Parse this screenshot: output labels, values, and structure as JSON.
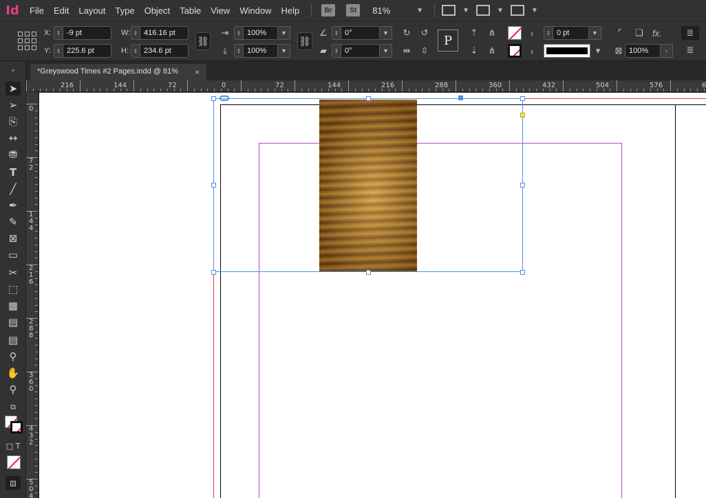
{
  "app": {
    "logo": "Id"
  },
  "menu": [
    "File",
    "Edit",
    "Layout",
    "Type",
    "Object",
    "Table",
    "View",
    "Window",
    "Help"
  ],
  "bridge": {
    "br": "Br",
    "st": "St"
  },
  "zoom": "81%",
  "control": {
    "x_label": "X:",
    "x_value": "-9 pt",
    "y_label": "Y:",
    "y_value": "225.6 pt",
    "w_label": "W:",
    "w_value": "416.16 pt",
    "h_label": "H:",
    "h_value": "234.6 pt",
    "scale_x": "100%",
    "scale_y": "100%",
    "rotate": "0°",
    "shear": "0°",
    "stroke_weight": "0 pt",
    "opacity": "100%",
    "p_button": "P",
    "fx": "fx."
  },
  "document_tab": {
    "title": "*Greyswood Times #2 Pages.indd @ 81%",
    "close": "×"
  },
  "ruler_top": [
    "216",
    "144",
    "72",
    "0",
    "72",
    "144",
    "216",
    "288",
    "360",
    "432",
    "504",
    "576",
    "6"
  ],
  "ruler_left": [
    "0",
    "72",
    "144",
    "216",
    "288",
    "360",
    "432",
    "504"
  ],
  "colors": {
    "accent": "#4a90e2",
    "margin": "#c040d0",
    "bleed": "#e23b3b",
    "logo": "#e63c8f"
  }
}
